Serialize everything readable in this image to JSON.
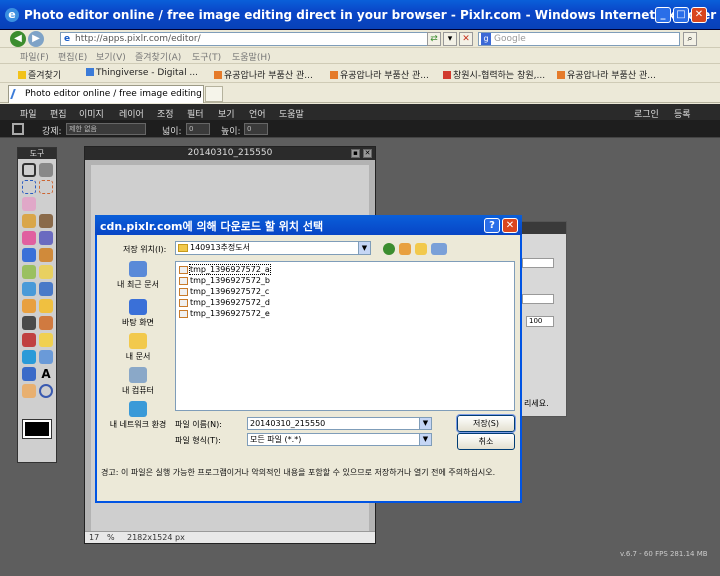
{
  "ie": {
    "title": "Photo editor online / free image editing direct in your browser - Pixlr.com - Windows Internet Explorer",
    "url": "http://apps.pixlr.com/editor/",
    "search_placeholder": "Google",
    "menu": [
      "파일(F)",
      "편집(E)",
      "보기(V)",
      "즐겨찾기(A)",
      "도구(T)",
      "도움말(H)"
    ],
    "favorites_label": "즐겨찾기",
    "favorites": [
      "Thingiverse - Digital ...",
      "유공압나라 부품산 관...",
      "유공압나라 부품산 관...",
      "창원시-협력하는 창원,...",
      "유공압나라 부품산 관..."
    ],
    "tab_title": "Photo editor online / free image editing di..."
  },
  "pixlr": {
    "menu": [
      "파일",
      "편집",
      "이미지",
      "레이어",
      "조정",
      "필터",
      "보기",
      "언어",
      "도움말"
    ],
    "right_menu": [
      "로그인",
      "등록"
    ],
    "options": {
      "constraint_label": "강제:",
      "constraint_value": "제한 없음",
      "width_label": "넓이:",
      "width_value": "0",
      "height_label": "높이:",
      "height_value": "0"
    },
    "tools_title": "도구",
    "doc": {
      "title": "20140310_215550",
      "zoom": "17",
      "zoom_unit": "%",
      "size": "2182x1524 px"
    },
    "bg_dialog": {
      "value": "100",
      "text": "리세요."
    },
    "fps": "v.6.7 - 60 FPS 281.14 MB"
  },
  "save_dialog": {
    "title": "cdn.pixlr.com에 의해 다운로드 할 위치 선택",
    "location_label": "저장 위치(I):",
    "location_value": "140913추정도서",
    "places": [
      "내 최근 문서",
      "바탕 화면",
      "내 문서",
      "내 컴퓨터",
      "내 네트워크 환경"
    ],
    "files": [
      "tmp_1396927572_a",
      "tmp_1396927572_b",
      "tmp_1396927572_c",
      "tmp_1396927572_d",
      "tmp_1396927572_e"
    ],
    "filename_label": "파일 이름(N):",
    "filename_value": "20140310_215550",
    "filetype_label": "파일 형식(T):",
    "filetype_value": "모든 파일 (*.*)",
    "save_button": "저장(S)",
    "cancel_button": "취소",
    "warning": "경고: 이 파일은 실행 가능한 프로그램이거나 악의적인 내용을 포함할 수 있으므로 저장하거나 열기 전에 주의하십시오."
  }
}
